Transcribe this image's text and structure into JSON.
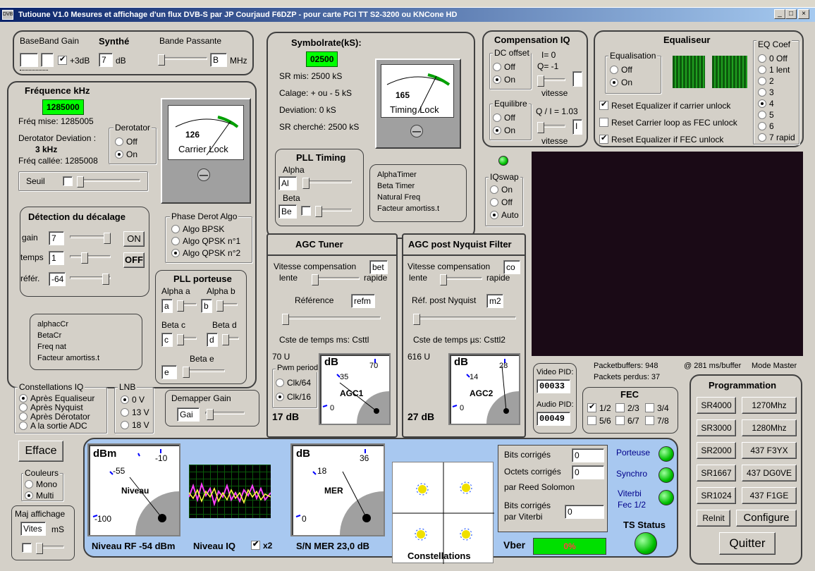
{
  "window": {
    "title": "Tutioune V1.0 Mesures et affichage d'un flux DVB-S par JP Courjaud F6DZP - pour carte PCI TT S2-3200 ou KNCone HD",
    "icon": "dvb-icon",
    "minimize": "_",
    "maximize": "□",
    "close": "×"
  },
  "baseband": {
    "gain_label": "BaseBand Gain",
    "synthe_label": "Synthé",
    "db_value": "7",
    "db_unit": "dB",
    "plus3db_label": "+3dB",
    "bande_label": "Bande Passante",
    "bande_value": "B",
    "mhz": "MHz"
  },
  "frequence": {
    "title": "Fréquence kHz",
    "value": "1285000",
    "freq_mise": "Fréq mise: 1285005",
    "derot_dev_label": "Derotator Deviation :",
    "derot_dev_value": "3 kHz",
    "freq_callee": "Fréq callée: 1285008",
    "derotator_title": "Derotator",
    "off": "Off",
    "on": "On",
    "seuil": "Seuil",
    "meter_value": "126",
    "meter_label": "Carrier Lock"
  },
  "detection": {
    "title": "Détection du décalage",
    "gain": "gain",
    "gain_val": "7",
    "temps": "temps",
    "temps_val": "1",
    "refer": "référ.",
    "refer_val": "-64",
    "btn_on": "ON",
    "btn_off": "OFF"
  },
  "alpha_block": {
    "lines": [
      "alphacCr",
      "BetaCr",
      "Freq nat",
      "Facteur amortiss.t"
    ]
  },
  "phase_derot": {
    "title": "Phase Derot Algo",
    "options": [
      "Algo BPSK",
      "Algo QPSK n°1",
      "Algo QPSK n°2"
    ]
  },
  "pll_porteuse": {
    "title": "PLL porteuse",
    "alpha_a": "Alpha a",
    "alpha_b": "Alpha b",
    "a_val": "a",
    "b_val": "b",
    "beta_c": "Beta c",
    "beta_d": "Beta d",
    "c_val": "c",
    "d_val": "d",
    "beta_e": "Beta e",
    "e_val": "e"
  },
  "symbolrate": {
    "title": "Symbolrate(kS):",
    "value": "02500",
    "sr_mis": "SR mis: 2500 kS",
    "calage": "Calage: + ou - 5 kS",
    "deviation": "Deviation:    0 kS",
    "sr_cherche": "SR cherché: 2500 kS",
    "meter_value": "165",
    "meter_label": "Timing Lock"
  },
  "pll_timing": {
    "title": "PLL Timing",
    "alpha": "Alpha",
    "alpha_val": "Al",
    "beta": "Beta",
    "beta_val": "Be",
    "lines": [
      "AlphaTimer",
      "Beta Timer",
      "Natural Freq",
      "Facteur amortiss.t"
    ]
  },
  "compensation": {
    "title": "Compensation IQ",
    "dc_offset": "DC offset",
    "off": "Off",
    "on": "On",
    "i_val": "I=  0",
    "q_val": "Q=  -1",
    "vitesse": "vitesse",
    "equilibre": "Equilibre",
    "qi": "Q / I = 1.03",
    "vitesse2": "vitesse",
    "i_box": "I"
  },
  "equaliseur": {
    "title": "Equaliseur",
    "equalisation": "Equalisation",
    "off": "Off",
    "on": "On",
    "reset1": "Reset Equalizer if carrier unlock",
    "reset2": "Reset Carrier loop as FEC unlock",
    "reset3": "Reset Equalizer if FEC unlock",
    "eq_coef": "EQ Coef",
    "coefs": [
      "0 Off",
      "1 lent",
      "2",
      "3",
      "4",
      "5",
      "6",
      "7 rapid"
    ]
  },
  "iqswap": {
    "title": "IQswap",
    "options": [
      "On",
      "Off",
      "Auto"
    ]
  },
  "agc_tuner": {
    "title": "AGC Tuner",
    "vitesse": "Vitesse compensation",
    "vitesse_val": "bet",
    "lente": "lente",
    "rapide": "rapide",
    "reference": "Référence",
    "ref_val": "refm",
    "cste": "Cste de temps ms:  Csttl",
    "seventy": "70 U",
    "pwm": "Pwm period",
    "clk64": "Clk/64",
    "clk16": "Clk/16",
    "db": "dB",
    "agc": "AGC1",
    "t0": "0",
    "t35": "35",
    "t70": "70",
    "value": "17 dB"
  },
  "agc_nyq": {
    "title": "AGC post Nyquist Filter",
    "vitesse": "Vitesse compensation",
    "vitesse_val": "co",
    "lente": "lente",
    "rapide": "rapide",
    "ref": "Réf. post Nyquist",
    "ref_val": "m2",
    "cste": "Cste de temps µs:   Csttl2",
    "u616": "616 U",
    "db": "dB",
    "agc": "AGC2",
    "t0": "0",
    "t14": "14",
    "t28": "28",
    "value": "27 dB"
  },
  "pid": {
    "video": "Video PID:",
    "video_val": "00033",
    "audio": "Audio PID:",
    "audio_val": "00049"
  },
  "packets": {
    "buffers": "Packetbuffers:   948",
    "perdus": "Packets perdus: 37",
    "ms": "@  281 ms/buffer",
    "master": "Mode Master"
  },
  "fec": {
    "title": "FEC",
    "opts": [
      "1/2",
      "2/3",
      "3/4",
      "5/6",
      "6/7",
      "7/8"
    ]
  },
  "programmation": {
    "title": "Programmation",
    "btns": [
      "SR4000",
      "1270Mhz",
      "SR3000",
      "1280Mhz",
      "SR2000",
      "437 F3YX",
      "SR1667",
      "437 DG0VE",
      "SR1024",
      "437 F1GE"
    ],
    "reinit": "ReInit",
    "configure": "Configure",
    "quitter": "Quitter"
  },
  "constellations_iq": {
    "title": "Constellations IQ",
    "options": [
      "Après Equaliseur",
      "Après Nyquist",
      "Après Dérotator",
      "A la sortie ADC"
    ]
  },
  "lnb": {
    "title": "LNB",
    "options": [
      "0 V",
      "13 V",
      "18 V"
    ]
  },
  "demapper": {
    "title": "Demapper Gain",
    "val": "Gai"
  },
  "efface": "Efface",
  "couleurs": {
    "title": "Couleurs",
    "mono": "Mono",
    "multi": "Multi"
  },
  "maj": {
    "title": "Maj affichage",
    "val": "Vites",
    "ms": "mS"
  },
  "bottom": {
    "dbm": "dBm",
    "t55": "-55",
    "t10": "-10",
    "t100": "-100",
    "niveau": "Niveau",
    "niveau_rf": "Niveau RF  -54 dBm",
    "niveau_iq": "Niveau IQ",
    "x2": "x2",
    "db": "dB",
    "t18": "18",
    "t36": "36",
    "t0": "0",
    "mer": "MER",
    "sn_mer": "S/N MER  23,0 dB",
    "constellations": "Constellations",
    "bits_corr": "Bits corrigés",
    "bits_val": "0",
    "octets_corr": "Octets corrigés",
    "octets_val": "0",
    "par_rs": "par Reed Solomon",
    "bits_viterbi": "Bits corrigés",
    "par_viterbi": "par Viterbi",
    "viterbi_val": "0",
    "vber": "Vber",
    "vber_val": "0%",
    "porteuse": "Porteuse",
    "synchro": "Synchro",
    "viterbi": "Viterbi",
    "fec12": "Fec 1/2",
    "ts_status": "TS Status"
  }
}
